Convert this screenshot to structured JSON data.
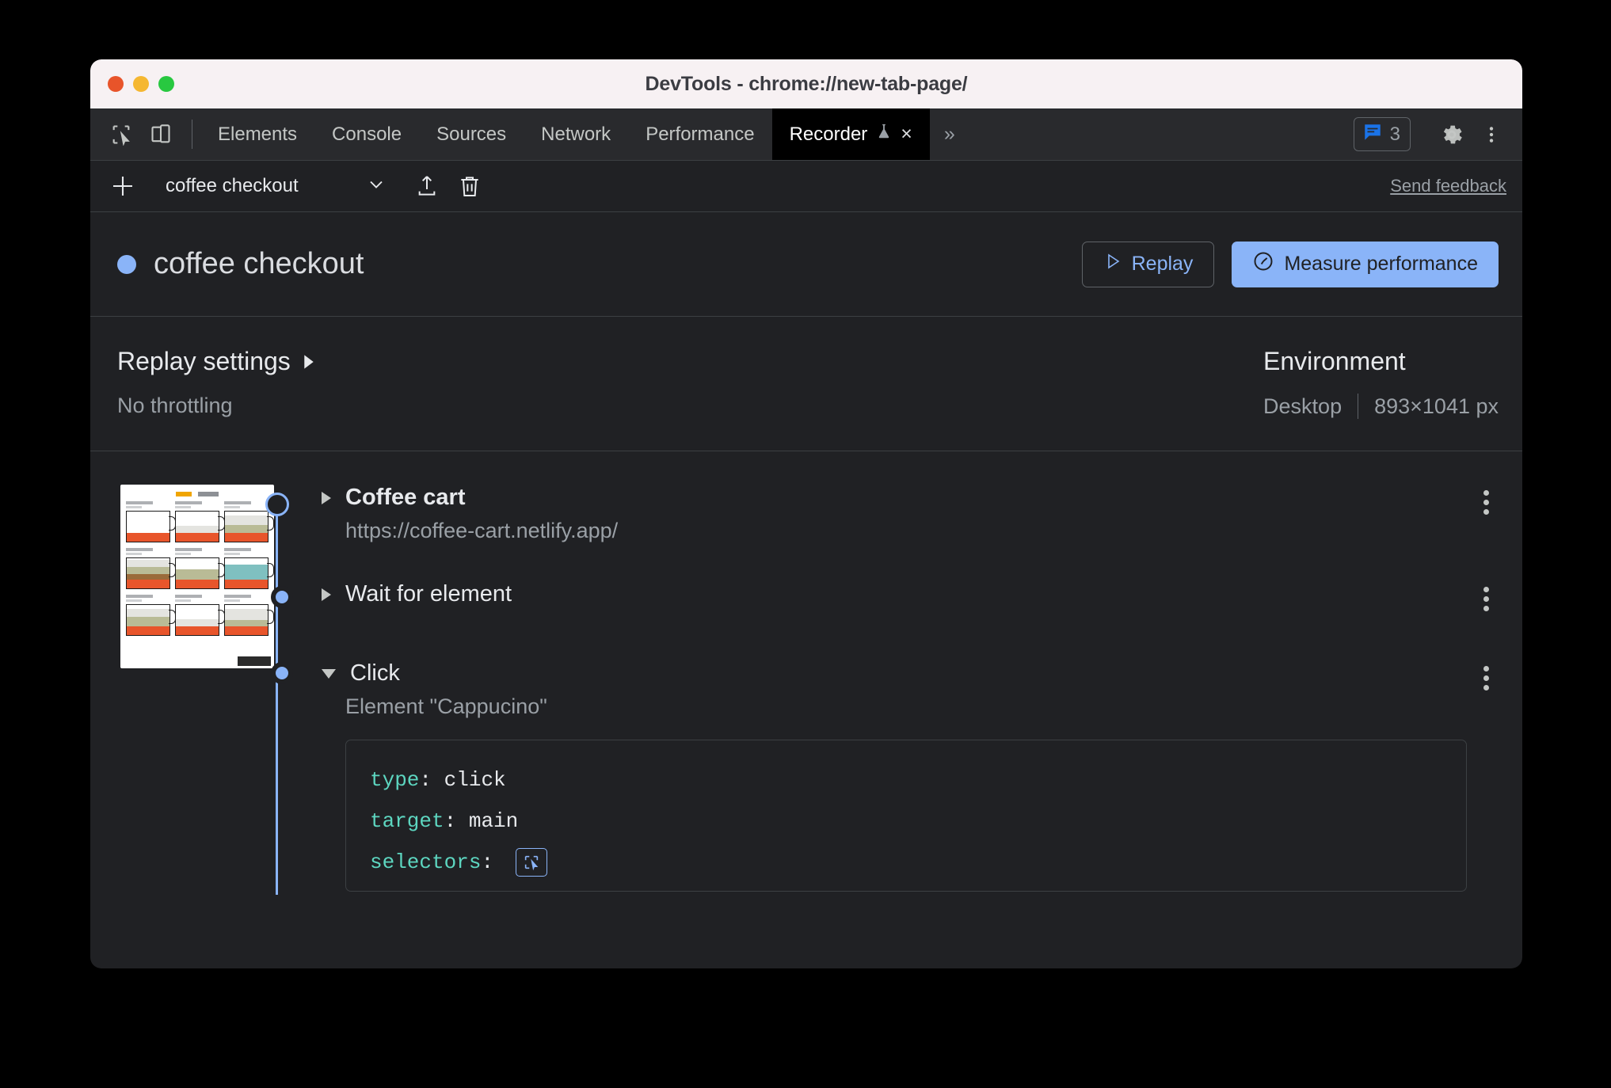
{
  "window": {
    "title": "DevTools - chrome://new-tab-page/",
    "traffic": {
      "close": "close-window",
      "minimize": "minimize-window",
      "zoom": "zoom-window"
    }
  },
  "tabstrip": {
    "inspect_icon": "inspect-element-icon",
    "device_icon": "device-toolbar-icon",
    "tabs": [
      {
        "label": "Elements",
        "active": false
      },
      {
        "label": "Console",
        "active": false
      },
      {
        "label": "Sources",
        "active": false
      },
      {
        "label": "Network",
        "active": false
      },
      {
        "label": "Performance",
        "active": false
      },
      {
        "label": "Recorder",
        "active": true,
        "experimental_icon": "flask-icon",
        "close": "×"
      }
    ],
    "more_tabs": "»",
    "messages": {
      "icon": "message-icon",
      "count": "3"
    },
    "settings_icon": "gear-icon",
    "more_icon": "more-vertical-icon"
  },
  "toolbar": {
    "add_icon": "plus-icon",
    "recording_name": "coffee checkout",
    "dropdown_icon": "chevron-down-icon",
    "export_icon": "export-icon",
    "delete_icon": "trash-icon",
    "feedback_label": "Send feedback"
  },
  "header": {
    "status_dot": "recording-status-dot",
    "title": "coffee checkout",
    "replay_label": "Replay",
    "replay_icon": "play-icon",
    "measure_label": "Measure performance",
    "measure_icon": "gauge-icon"
  },
  "settings": {
    "replay_settings_label": "Replay settings",
    "expand_icon": "chevron-right-icon",
    "throttling": "No throttling",
    "environment_label": "Environment",
    "device": "Desktop",
    "viewport": "893×1041 px"
  },
  "screenshot_thumbnail": {
    "name": "recording-screenshot-thumbnail",
    "alt": "coffee cart page screenshot"
  },
  "steps": [
    {
      "title": "Coffee cart",
      "subtitle": "https://coffee-cart.netlify.app/",
      "expanded": false,
      "node": "ring",
      "bold": true,
      "menu": "step-menu-icon"
    },
    {
      "title": "Wait for element",
      "subtitle": "",
      "expanded": false,
      "node": "filled",
      "bold": false,
      "menu": "step-menu-icon"
    },
    {
      "title": "Click",
      "subtitle": "Element \"Cappucino\"",
      "expanded": true,
      "node": "filled",
      "bold": false,
      "menu": "step-menu-icon",
      "code": [
        {
          "key": "type",
          "value": "click"
        },
        {
          "key": "target",
          "value": "main"
        },
        {
          "key": "selectors",
          "value": "",
          "picker": "select-element-icon"
        }
      ]
    }
  ],
  "colors": {
    "accent_blue": "#8ab4f8",
    "panel_bg": "#202124",
    "tabstrip_bg": "#292a2d",
    "titlebar_bg": "#f7f1f3",
    "code_key": "#5dd6c0",
    "text_primary": "#e8eaed",
    "text_secondary": "#9aa0a6"
  }
}
